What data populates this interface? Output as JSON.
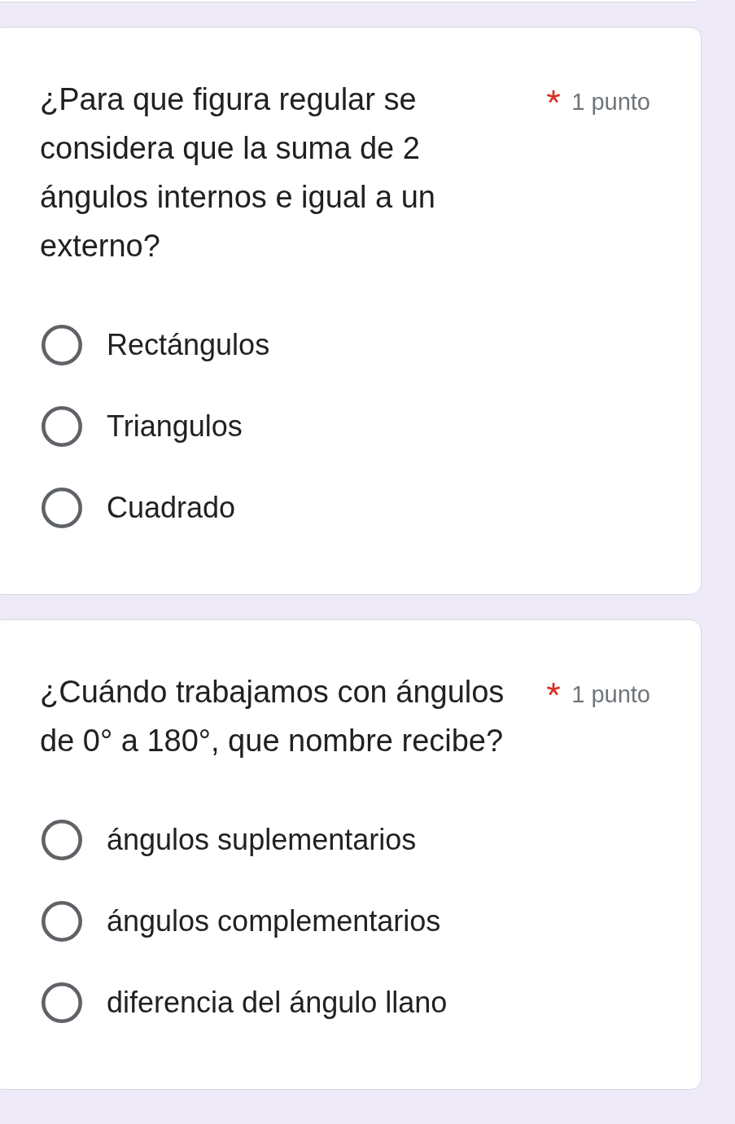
{
  "questions": [
    {
      "text": "¿Para que figura regular se considera que la suma de 2 ángulos internos e igual a un externo?",
      "required": true,
      "points": "1 punto",
      "options": [
        {
          "label": "Rectángulos",
          "selected": false
        },
        {
          "label": "Triangulos",
          "selected": false
        },
        {
          "label": "Cuadrado",
          "selected": false
        }
      ]
    },
    {
      "text": "¿Cuándo trabajamos con ángulos de 0° a 180°, que nombre recibe?",
      "required": true,
      "points": "1 punto",
      "options": [
        {
          "label": "ángulos suplementarios",
          "selected": false
        },
        {
          "label": "ángulos complementarios",
          "selected": false
        },
        {
          "label": "diferencia del ángulo llano",
          "selected": false
        }
      ]
    }
  ]
}
